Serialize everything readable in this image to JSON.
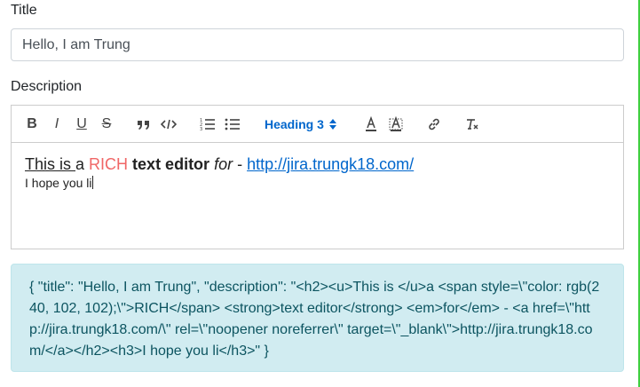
{
  "form": {
    "title_label": "Title",
    "title_value": "Hello, I am Trung",
    "description_label": "Description"
  },
  "toolbar": {
    "buttons": [
      {
        "name": "bold",
        "icon": "bold-icon",
        "glyph": "B"
      },
      {
        "name": "italic",
        "icon": "italic-icon",
        "glyph": "I"
      },
      {
        "name": "underline",
        "icon": "underline-icon",
        "glyph": "U"
      },
      {
        "name": "strike",
        "icon": "strikethrough-icon",
        "glyph": "S"
      },
      {
        "name": "blockquote",
        "icon": "quote-icon"
      },
      {
        "name": "code",
        "icon": "code-icon"
      },
      {
        "name": "ordered-list",
        "icon": "ordered-list-icon"
      },
      {
        "name": "bullet-list",
        "icon": "bullet-list-icon"
      },
      {
        "name": "font-color",
        "icon": "font-color-icon"
      },
      {
        "name": "background-color",
        "icon": "background-color-icon"
      },
      {
        "name": "link",
        "icon": "link-icon"
      },
      {
        "name": "clear-format",
        "icon": "clear-format-icon"
      }
    ],
    "heading_value": "Heading 3",
    "accent_color": "#0066cc"
  },
  "editor": {
    "line1": {
      "underlined": "This is ",
      "plain1": "a ",
      "rich": "RICH",
      "rich_color": "#f06666",
      "strong": "text editor",
      "em": "for",
      "plain2": " - ",
      "link": "http://jira.trungk18.com/"
    },
    "line2": "I hope you li"
  },
  "output": {
    "json_text": "{ \"title\": \"Hello, I am Trung\", \"description\": \"<h2><u>This is </u>a <span style=\\\"color: rgb(240, 102, 102);\\\">RICH</span> <strong>text editor</strong> <em>for</em> - <a href=\\\"http://jira.trungk18.com/\\\" rel=\\\"noopener noreferrer\\\" target=\\\"_blank\\\">http://jira.trungk18.com/</a></h2><h3>I hope you li</h3>\" }"
  }
}
